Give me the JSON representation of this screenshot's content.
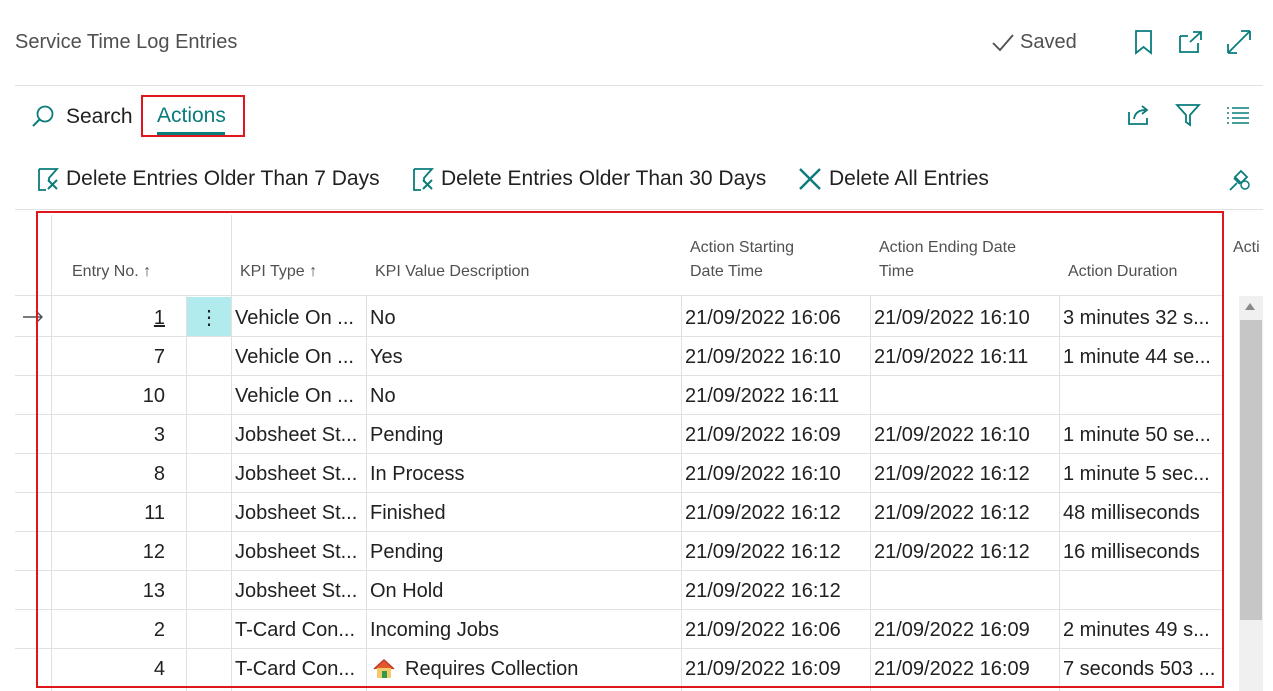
{
  "window": {
    "title": "Service Time Log Entries",
    "saved_label": "Saved"
  },
  "actionbar": {
    "search_label": "Search",
    "actions_label": "Actions"
  },
  "commands": [
    {
      "label": "Delete Entries Older Than 7 Days"
    },
    {
      "label": "Delete Entries Older Than 30 Days"
    },
    {
      "label": "Delete All Entries"
    }
  ],
  "table": {
    "headers": {
      "entry_no": "Entry No. ↑",
      "kpi_type": "KPI Type ↑",
      "kpi_value": "KPI Value Description",
      "start_line1": "Action Starting",
      "start_line2": "Date Time",
      "end_line1": "Action Ending Date",
      "end_line2": "Time",
      "duration": "Action Duration",
      "next_col": "Acti"
    },
    "rows": [
      {
        "entry": "1",
        "type": "Vehicle On ...",
        "value": "No",
        "start": "21/09/2022 16:06",
        "end": "21/09/2022 16:10",
        "duration": "3 minutes 32 s..."
      },
      {
        "entry": "7",
        "type": "Vehicle On ...",
        "value": "Yes",
        "start": "21/09/2022 16:10",
        "end": "21/09/2022 16:11",
        "duration": "1 minute 44 se..."
      },
      {
        "entry": "10",
        "type": "Vehicle On ...",
        "value": "No",
        "start": "21/09/2022 16:11",
        "end": "",
        "duration": ""
      },
      {
        "entry": "3",
        "type": "Jobsheet St...",
        "value": "Pending",
        "start": "21/09/2022 16:09",
        "end": "21/09/2022 16:10",
        "duration": "1 minute 50 se..."
      },
      {
        "entry": "8",
        "type": "Jobsheet St...",
        "value": "In Process",
        "start": "21/09/2022 16:10",
        "end": "21/09/2022 16:12",
        "duration": "1 minute 5 sec..."
      },
      {
        "entry": "11",
        "type": "Jobsheet St...",
        "value": "Finished",
        "start": "21/09/2022 16:12",
        "end": "21/09/2022 16:12",
        "duration": "48 milliseconds"
      },
      {
        "entry": "12",
        "type": "Jobsheet St...",
        "value": "Pending",
        "start": "21/09/2022 16:12",
        "end": "21/09/2022 16:12",
        "duration": "16 milliseconds"
      },
      {
        "entry": "13",
        "type": "Jobsheet St...",
        "value": "On Hold",
        "start": "21/09/2022 16:12",
        "end": "",
        "duration": ""
      },
      {
        "entry": "2",
        "type": "T-Card Con...",
        "value": "Incoming Jobs",
        "start": "21/09/2022 16:06",
        "end": "21/09/2022 16:09",
        "duration": "2 minutes 49 s..."
      },
      {
        "entry": "4",
        "type": "T-Card Con...",
        "value": "Requires Collection",
        "start": "21/09/2022 16:09",
        "end": "21/09/2022 16:09",
        "duration": "7 seconds 503 ..."
      }
    ]
  },
  "colors": {
    "accent": "#0a7c7c",
    "highlight_box": "#e0161d",
    "selected_cell": "#b2ebee"
  }
}
